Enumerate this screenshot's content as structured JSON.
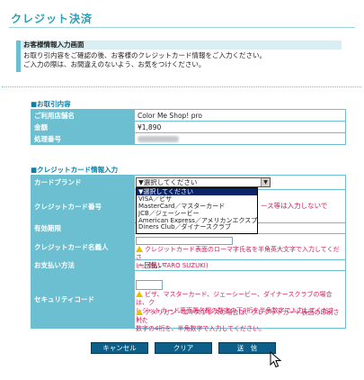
{
  "page": {
    "title": "クレジット決済"
  },
  "info": {
    "heading": "お客様情報入力画面",
    "line1": "お取り引内容をご確認の後、お客様のクレジットカード情報をご入力ください。",
    "line2": "ご入力の際は、お間違えのないよう、お気をつけください。"
  },
  "order": {
    "section_title": "■お取引内容",
    "rows": [
      {
        "label": "ご利用店舗名",
        "value": "Color Me Shop! pro"
      },
      {
        "label": "金額",
        "value": "¥1,890"
      },
      {
        "label": "処理番号",
        "value": ""
      }
    ]
  },
  "card": {
    "section_title": "■クレジットカード情報入力",
    "brand_label": "カードブランド",
    "brand_selected": "▼選択してください",
    "brand_options": [
      "▼選択してください",
      "VISA／ビザ",
      "MasterCard／マスターカード",
      "JCB／ジェーシービー",
      "American Express／アメリカンエクスプレス",
      "Diners Club／ダイナースクラブ"
    ],
    "number_label": "クレジットカード番号",
    "number_note_partial": "ース等は入力しないで",
    "expiry_label": "有効期限",
    "holder_label": "クレジットカード名義人",
    "holder_note_line1": "クレジットカード表面のローマ字氏名を半角英大文字で入力してくださ",
    "holder_note_line2": "い。(例：TARO SUZUKI)",
    "payment_label": "お支払い方法",
    "payment_value": "一回払い",
    "cvv_label": "セキュリティコード",
    "cvv_note1_line1": "ビザ、マスターカード、ジェーシービー、ダイナースクラブの場合は、ク",
    "cvv_note1_line2": "レジットカード裏面署名欄の数字の下3桁を半角数字で入力してください。",
    "cvv_note2_line1": "アメリカン・エキスプレスの場合は、クレジットカード表面の印刷された",
    "cvv_note2_line2": "数字の4桁を、半角数字で入力してください。"
  },
  "buttons": {
    "cancel": "キャンセル",
    "clear": "クリア",
    "submit": "送　信"
  },
  "colors": {
    "accent": "#2aa0b6",
    "label_bg": "#6bbfd0",
    "warning_text": "#d21b5a",
    "button_bg": "#0b5f88"
  },
  "icons": {
    "warning": "warning-triangle-icon",
    "cursor": "mouse-pointer-icon"
  }
}
